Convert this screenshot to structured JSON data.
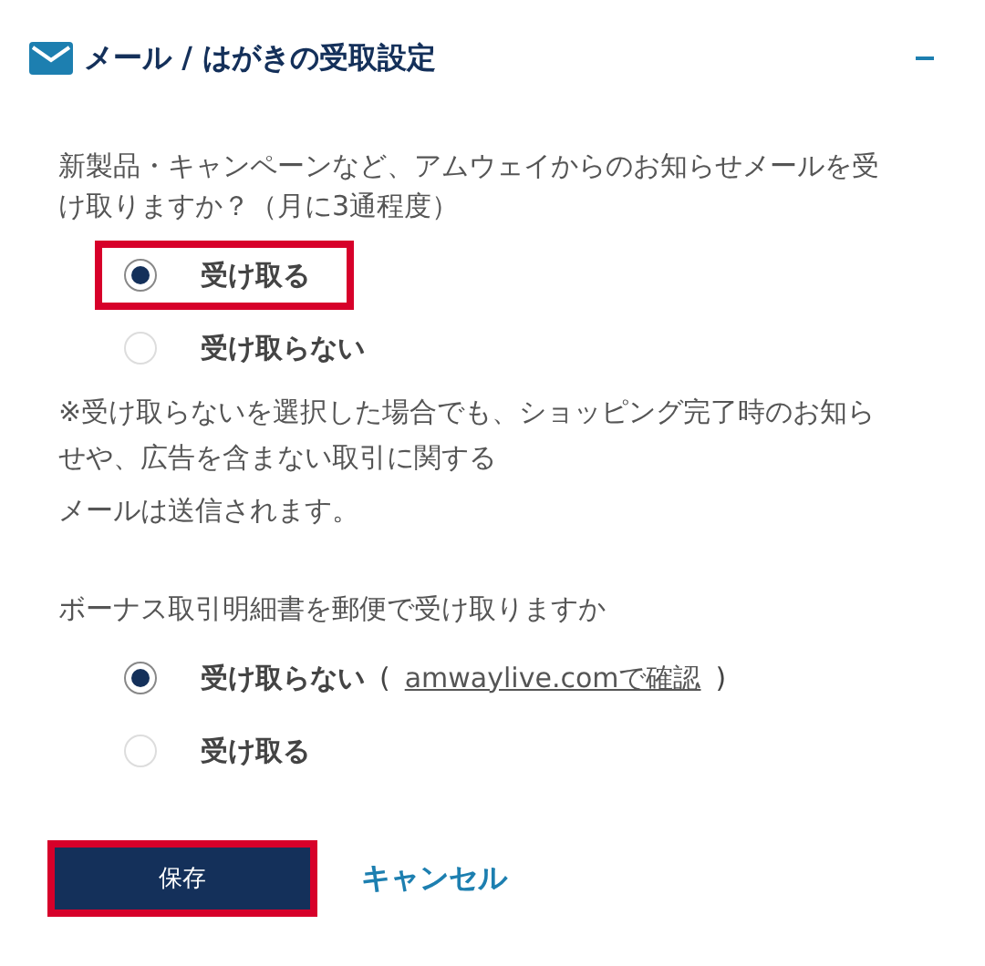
{
  "section": {
    "title": "メール / はがきの受取設定",
    "expanded": true
  },
  "groups": [
    {
      "question": "新製品・キャンペーンなど、アムウェイからのお知らせメールを受け取りますか？（月に3通程度）",
      "options": [
        {
          "label": "受け取る",
          "selected": true,
          "highlighted": true
        },
        {
          "label": "受け取らない",
          "selected": false,
          "highlighted": false
        }
      ],
      "note_lines": [
        "※受け取らないを選択した場合でも、ショッピング完了時のお知らせや、広告を含まない取引に関する",
        "メールは送信されます。"
      ]
    },
    {
      "question": "ボーナス取引明細書を郵便で受け取りますか",
      "options": [
        {
          "label": "受け取らない",
          "selected": true,
          "highlighted": false,
          "link_open": "(",
          "link": "amwaylive.comで確認",
          "link_close": ")"
        },
        {
          "label": "受け取る",
          "selected": false,
          "highlighted": false
        }
      ]
    }
  ],
  "actions": {
    "save": {
      "label": "保存",
      "highlighted": true
    },
    "cancel": {
      "label": "キャンセル"
    }
  }
}
